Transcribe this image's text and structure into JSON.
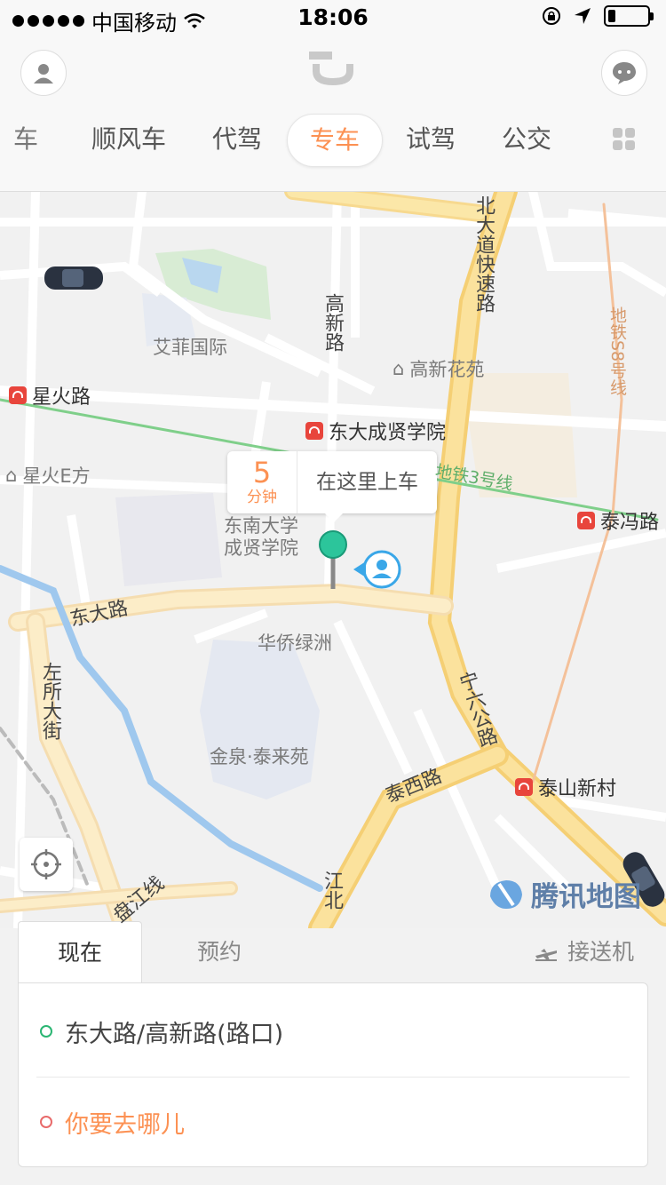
{
  "status_bar": {
    "carrier": "中国移动",
    "time": "18:06",
    "battery_level": 0.2
  },
  "header": {
    "tabs": [
      {
        "label": "车"
      },
      {
        "label": "顺风车"
      },
      {
        "label": "代驾"
      },
      {
        "label": "专车"
      },
      {
        "label": "试驾"
      },
      {
        "label": "公交"
      }
    ],
    "active_tab": "专车",
    "icons": {
      "profile": "person-icon",
      "message": "chat-bubble-icon",
      "more": "grid-icon",
      "logo": "didi-logo"
    }
  },
  "map": {
    "road_labels": {
      "gaoxin_road": "高新路",
      "beidadao": "北大道快速路",
      "dongda_road": "东大路",
      "zuosuo": "左所大街",
      "taixi_road": "泰西路",
      "ningliu": "宁六公路",
      "panjiang": "盘江线",
      "jiang": "江北",
      "metro3": "地铁3号线",
      "metro8": "地铁S8号线"
    },
    "area_labels": {
      "aifei": "艾菲国际",
      "gaoxin_garden": "高新花苑",
      "xinghuo_e": "星火E方",
      "seu": "东南大学成贤学院",
      "huaqiao": "华侨绿洲",
      "jinquan": "金泉·泰来苑"
    },
    "pois": {
      "xinghuo_road": "星火路",
      "dongda_cx": "东大成贤学院",
      "taifeng_road": "泰冯路",
      "taishan_village": "泰山新村"
    },
    "callout": {
      "minutes": "5",
      "unit": "分钟",
      "text": "在这里上车"
    },
    "watermark": "腾讯地图"
  },
  "booking": {
    "tabs": {
      "now": "现在",
      "reserve": "预约",
      "airport": "接送机"
    },
    "origin": "东大路/高新路(路口)",
    "destination_placeholder": "你要去哪儿",
    "colors": {
      "origin": "#2bb673",
      "destination": "#fc9153",
      "dest_dot": "#e86a6a"
    }
  }
}
